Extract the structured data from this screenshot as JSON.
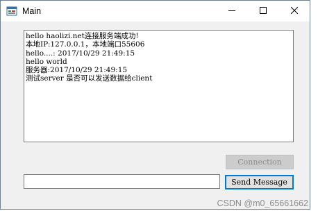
{
  "window": {
    "title": "Main",
    "icon": "form-app-icon"
  },
  "titlebar_controls": {
    "minimize_icon": "minimize-icon",
    "maximize_icon": "maximize-icon",
    "close_icon": "close-icon"
  },
  "log": {
    "lines": [
      "hello haolizi.net连接服务端成功!",
      "本地IP:127.0.0.1，本地端口55606",
      "hello....: 2017/10/29 21:49:15",
      "hello world",
      "服务器:2017/10/29 21:49:15",
      "测试server 是否可以发送数据给client"
    ]
  },
  "buttons": {
    "connection_label": "Connection",
    "connection_enabled": false,
    "send_label": "Send Message"
  },
  "message_input": {
    "value": "",
    "placeholder": ""
  },
  "watermark": "CSDN @m0_65661662"
}
